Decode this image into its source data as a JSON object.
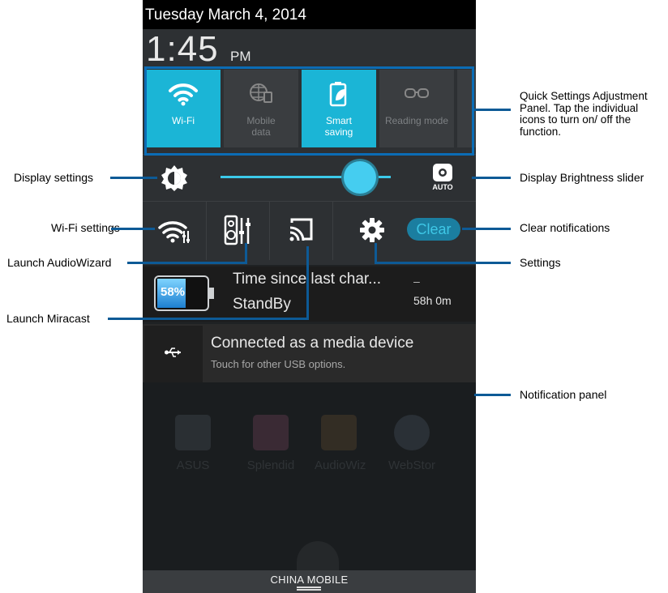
{
  "status": {
    "date": "Tuesday March 4, 2014",
    "time": "1:45",
    "ampm": "PM"
  },
  "quick_settings": {
    "tiles": [
      {
        "label": "Wi-Fi",
        "state": "on",
        "icon": "wifi-icon"
      },
      {
        "label": "Mobile data",
        "state": "off",
        "icon": "globe-sim-icon"
      },
      {
        "label": "Smart saving",
        "state": "on",
        "icon": "battery-leaf-icon"
      },
      {
        "label": "Reading mode",
        "state": "off",
        "icon": "glasses-icon"
      }
    ]
  },
  "brightness": {
    "level": 0.82,
    "auto_label": "AUTO"
  },
  "quick_row": {
    "clear_label": "Clear"
  },
  "battery_notification": {
    "percent": "58%",
    "title": "Time since last char...",
    "subtitle": "StandBy",
    "dash": "–",
    "duration": "58h 0m"
  },
  "usb_notification": {
    "title": "Connected as a media device",
    "subtitle": "Touch for other USB options."
  },
  "home_apps": [
    "ASUS",
    "Splendid",
    "AudioWiz",
    "WebStor"
  ],
  "carrier": "CHINA MOBILE",
  "callouts": {
    "quick_settings_panel": "Quick Settings Adjustment Panel. Tap the individual icons to turn on/ off the function.",
    "display_settings": "Display settings",
    "display_brightness_slider": "Display Brightness slider",
    "wifi_settings": "Wi-Fi settings",
    "clear_notifications": "Clear notifications",
    "launch_audiowizard": "Launch AudioWizard",
    "settings": "Settings",
    "launch_miracast": "Launch Miracast",
    "notification_panel": "Notification panel"
  },
  "colors": {
    "accent": "#1bb5d6",
    "callout_line": "#0d5a96",
    "highlight_box": "#0b6cb5"
  }
}
